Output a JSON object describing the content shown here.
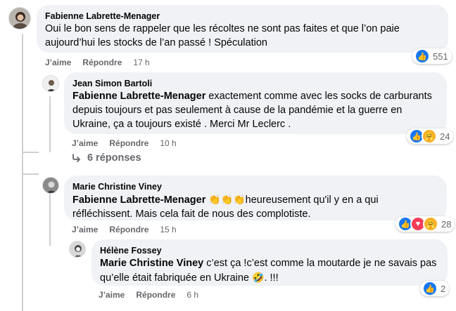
{
  "comments": [
    {
      "author": "Fabienne Labrette-Menager",
      "text": "Oui le bon sens de rappeler que les récoltes ne sont pas faites et que l’on paie aujourd’hui les stocks de l’an passé ! Spéculation",
      "like_label": "J’aime",
      "reply_label": "Répondre",
      "time": "17 h",
      "reaction_count": "551"
    },
    {
      "author": "Jean Simon Bartoli",
      "mention": "Fabienne Labrette-Menager",
      "text": " exactement comme avec les socks de carburants depuis toujours et pas seulement à cause de la pandémie et la guerre en Ukraine, ça a toujours existé . Merci Mr Leclerc .",
      "like_label": "J’aime",
      "reply_label": "Répondre",
      "time": "10 h",
      "reaction_count": "24"
    },
    {
      "author": "Marie Christine Viney",
      "mention": "Fabienne Labrette-Menager",
      "emoji": "👏👏👏",
      "text": "heureusement qu'il y en a qui réfléchissent. Mais cela fait de nous des complotiste.",
      "like_label": "J’aime",
      "reply_label": "Répondre",
      "time": "15 h",
      "reaction_count": "28"
    },
    {
      "author": "Hélène Fossey",
      "mention": "Marie Christine Viney",
      "text": " c’est ça !c’est comme la moutarde je ne savais pas qu’elle était fabriquée en Ukraine",
      "emoji_end": "🤣",
      "text_end": ". !!!",
      "like_label": "J’aime",
      "reply_label": "Répondre",
      "time": "6 h",
      "reaction_count": "2"
    }
  ],
  "replies_link": "6 réponses",
  "icons": {
    "like": "thumbs-up-icon",
    "love": "heart-icon",
    "care": "care-icon",
    "reply_arrow": "reply-arrow-icon"
  },
  "colors": {
    "bubble": "#f0f2f5",
    "secondary_text": "#65676b",
    "like_blue": "#1877f2",
    "love_red": "#f33e58",
    "care_yellow": "#f7b125"
  }
}
